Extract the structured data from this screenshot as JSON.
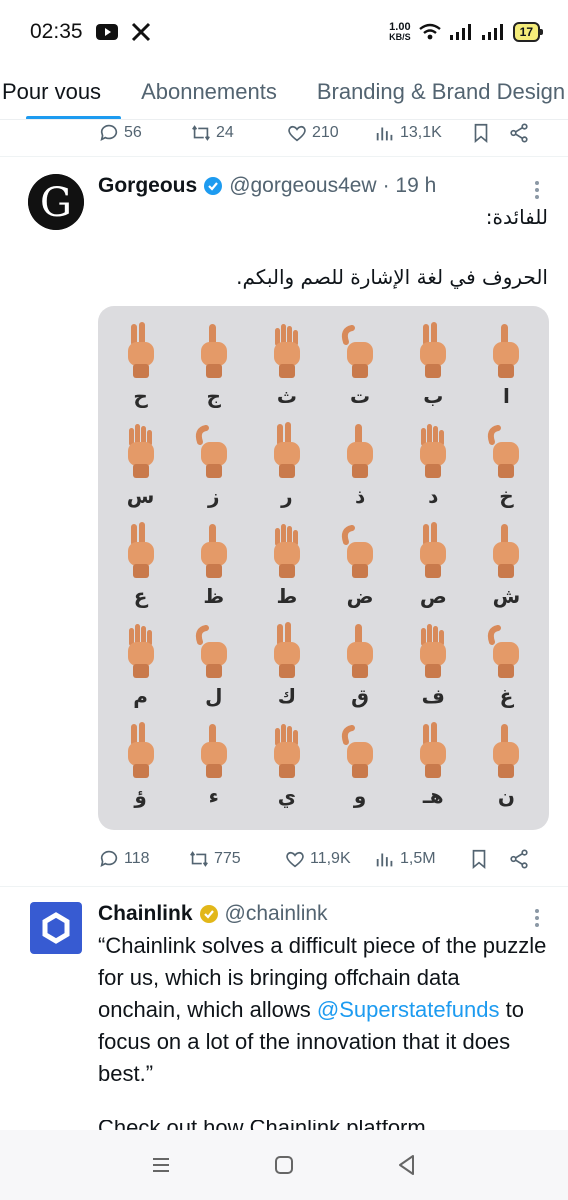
{
  "status": {
    "time": "02:35",
    "speed_value": "1.00",
    "speed_unit": "KB/S",
    "battery": "17"
  },
  "tabs": [
    {
      "label": "Pour vous"
    },
    {
      "label": "Abonnements"
    },
    {
      "label": "Branding & Brand Design"
    }
  ],
  "prev_tweet": {
    "replies": "56",
    "retweets": "24",
    "likes": "210",
    "views": "13,1K"
  },
  "tweet1": {
    "name": "Gorgeous",
    "handle": "@gorgeous4ew",
    "time": "· 19 h",
    "line1": "للفائدة:",
    "line2": "الحروف في لغة الإشارة للصم والبكم.",
    "letters": [
      "ا",
      "ب",
      "ت",
      "ث",
      "ج",
      "ح",
      "خ",
      "د",
      "ذ",
      "ر",
      "ز",
      "س",
      "ش",
      "ص",
      "ض",
      "ط",
      "ظ",
      "ع",
      "غ",
      "ف",
      "ق",
      "ك",
      "ل",
      "م",
      "ن",
      "هـ",
      "و",
      "ي",
      "ء",
      "ؤ"
    ],
    "replies": "118",
    "retweets": "775",
    "likes": "11,9K",
    "views": "1,5M"
  },
  "tweet2": {
    "name": "Chainlink",
    "handle": "@chainlink",
    "quote_start": "“Chainlink solves a difficult piece of the puzzle for us, which is bringing offchain data onchain, which allows ",
    "mention": "@Superstatefunds",
    "quote_end": " to focus on a lot of the innovation that it does best.”",
    "cutoff": "Check out how Chainlink platform"
  },
  "colors": {
    "accent": "#1d9bf0",
    "verified_blue": "#1d9bf0",
    "verified_gold": "#e2b719",
    "chainlink_blue": "#375bd2"
  }
}
